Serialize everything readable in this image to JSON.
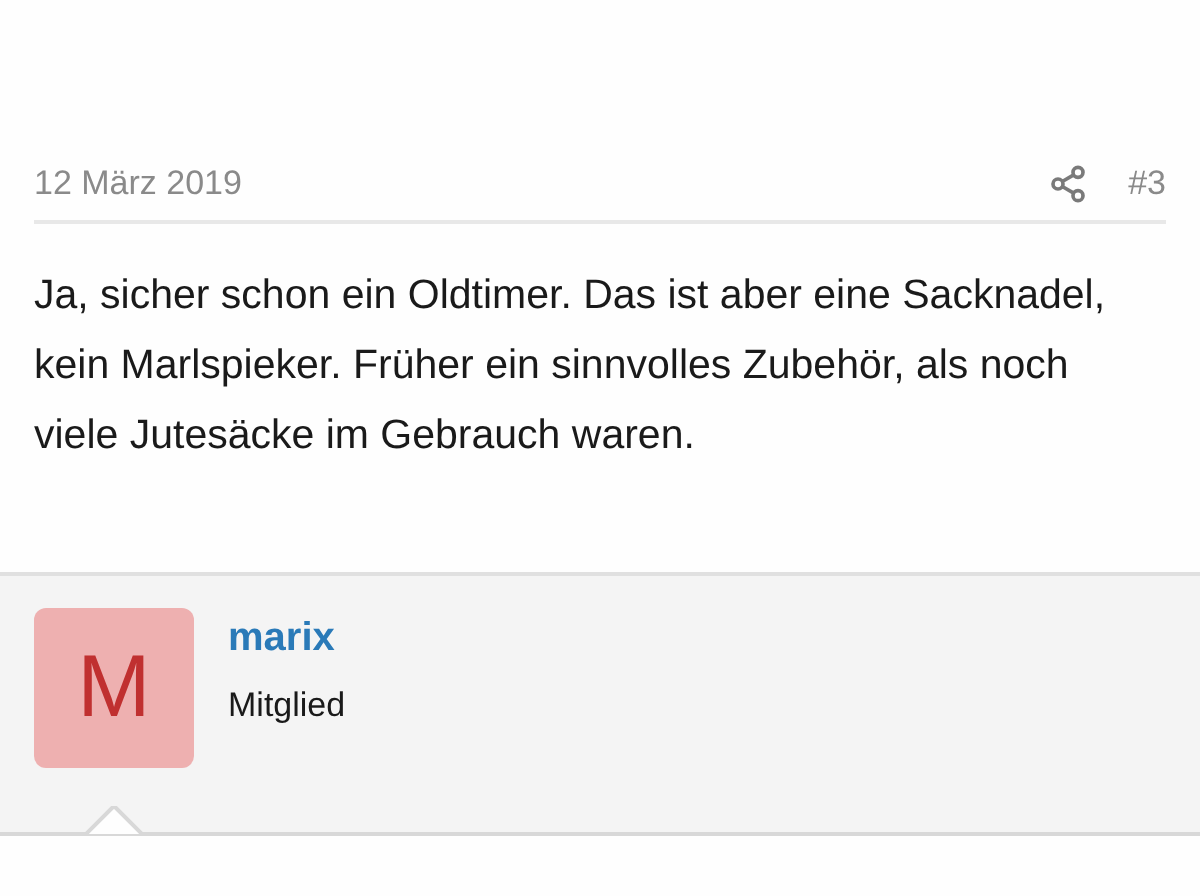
{
  "posts": [
    {
      "date": "12 März 2019",
      "number": "#3",
      "body": "Ja, sicher schon ein Oldtimer. Das ist aber eine Sacknadel, kein Marlspieker. Früher ein sinnvolles Zubehör, als noch viele Jutesäcke im Gebrauch waren."
    }
  ],
  "next_author": {
    "avatar_letter": "M",
    "name": "marix",
    "role": "Mitglied"
  }
}
